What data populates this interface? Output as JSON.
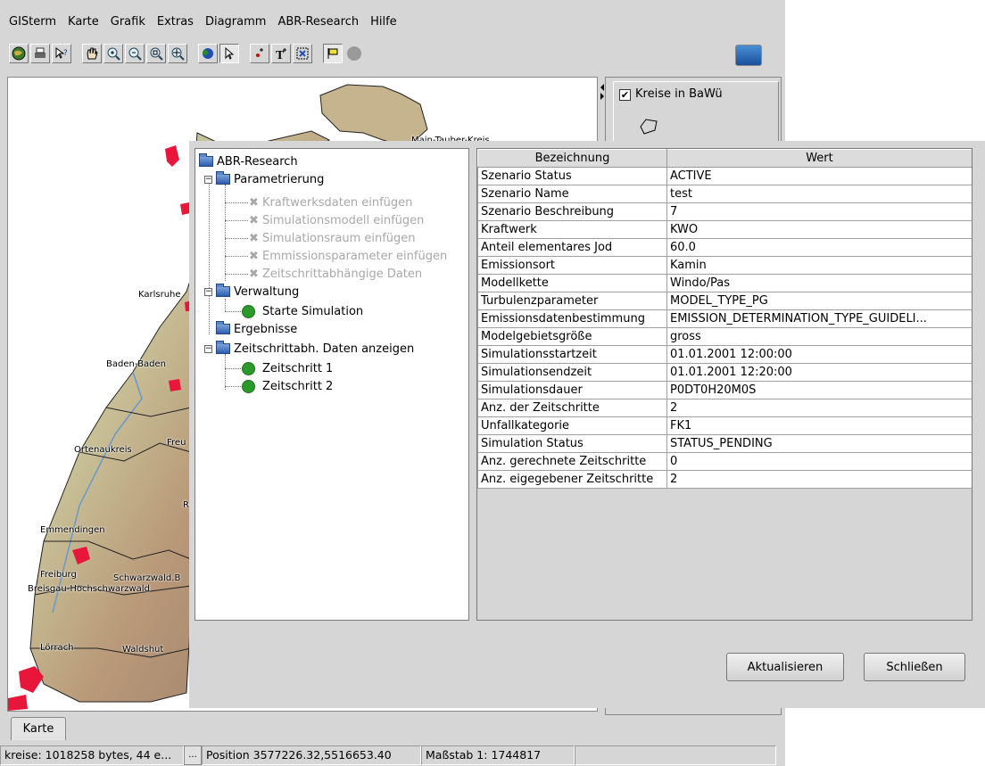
{
  "menu": [
    {
      "label": "GISterm"
    },
    {
      "label": "Karte"
    },
    {
      "label": "Grafik"
    },
    {
      "label": "Extras"
    },
    {
      "label": "Diagramm"
    },
    {
      "label": "ABR-Research"
    },
    {
      "label": "Hilfe"
    }
  ],
  "toolbar_icons": [
    "globe-icon",
    "printer-icon",
    "help-pointer-icon",
    "hand-pan-icon",
    "zoom-in-icon",
    "zoom-out-icon",
    "zoom-area-icon",
    "zoom-full-icon",
    "info-icon",
    "select-pointer-icon",
    "point-icon",
    "text-icon",
    "select-area-icon",
    "flag-icon",
    "stop-icon",
    "database-globe-icon"
  ],
  "legend": {
    "layer_label": "Kreise in BaWü",
    "checked": true
  },
  "map_labels": {
    "karlsruhe": "Karlsruhe",
    "baden_baden": "Baden-Baden",
    "ortenaukreis": "Ortenaukreis",
    "freu": "Freu",
    "emmendingen": "Emmendingen",
    "freiburg": "Freiburg",
    "breisgau": "Breisgau-Hochschwarzwald",
    "schwarzwald": "Schwarzwald.B",
    "loerrach": "Lörrach",
    "waldshut": "Waldshut",
    "ro": "Ro",
    "main_tauber": "Main-Tauber-Kreis"
  },
  "tabs": {
    "karte": "Karte"
  },
  "status": {
    "memory": "kreise: 1018258 bytes, 44 e...",
    "more": "...",
    "position": "Position 3577226.32,5516653.40",
    "scale": "Maßstab 1: 1744817"
  },
  "tree": {
    "root": "ABR-Research",
    "parametrierung": "Parametrierung",
    "param_items": [
      "Kraftwerksdaten einfügen",
      "Simulationsmodell einfügen",
      "Simulationsraum einfügen",
      "Emmissionsparameter einfügen",
      "Zeitschrittabhängige Daten"
    ],
    "verwaltung": "Verwaltung",
    "starte": "Starte Simulation",
    "ergebnisse": "Ergebnisse",
    "zeitschritt_anzeigen": "Zeitschrittabh. Daten anzeigen",
    "zeitschritte": [
      "Zeitschritt 1",
      "Zeitschritt 2"
    ]
  },
  "table": {
    "headers": [
      "Bezeichnung",
      "Wert"
    ],
    "rows": [
      [
        "Szenario Status",
        "ACTIVE"
      ],
      [
        "Szenario Name",
        "test"
      ],
      [
        "Szenario Beschreibung",
        "7"
      ],
      [
        "Kraftwerk",
        "KWO"
      ],
      [
        "Anteil elementares Jod",
        "60.0"
      ],
      [
        "Emissionsort",
        "Kamin"
      ],
      [
        "Modellkette",
        "Windo/Pas"
      ],
      [
        "Turbulenzparameter",
        "MODEL_TYPE_PG"
      ],
      [
        "Emissionsdatenbestimmung",
        "EMISSION_DETERMINATION_TYPE_GUIDELI..."
      ],
      [
        "Modelgebietsgröße",
        "gross"
      ],
      [
        "Simulationsstartzeit",
        "01.01.2001 12:00:00"
      ],
      [
        "Simulationsendzeit",
        "01.01.2001 12:20:00"
      ],
      [
        "Simulationsdauer",
        "P0DT0H20M0S"
      ],
      [
        "Anz. der Zeitschritte",
        "2"
      ],
      [
        "Unfallkategorie",
        "FK1"
      ],
      [
        "Simulation Status",
        "STATUS_PENDING"
      ],
      [
        "Anz. gerechnete Zeitschritte",
        "0"
      ],
      [
        "Anz. eigegebener Zeitschritte",
        "2"
      ]
    ]
  },
  "buttons": {
    "refresh": "Aktualisieren",
    "close": "Schließen"
  }
}
